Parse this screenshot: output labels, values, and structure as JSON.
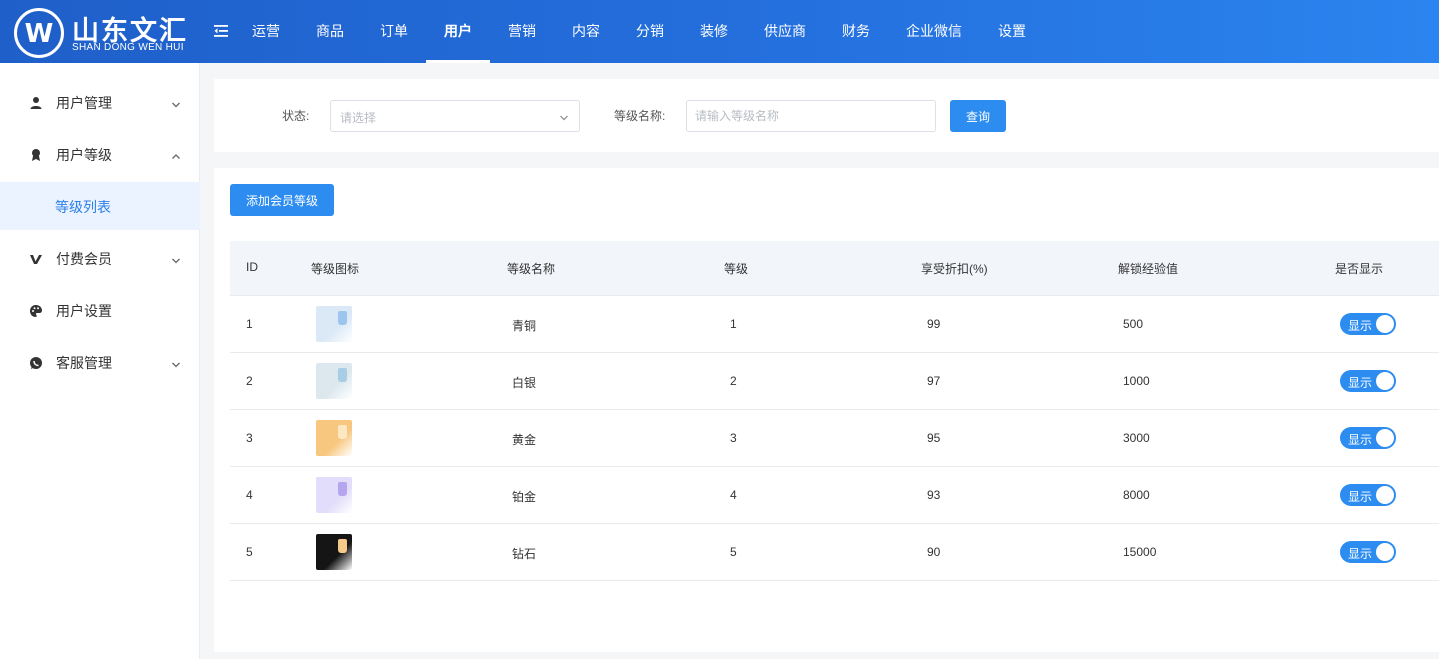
{
  "logo": {
    "name": "山东文汇",
    "subtitle": "SHAN DONG WEN HUI"
  },
  "nav": {
    "items": [
      "运营",
      "商品",
      "订单",
      "用户",
      "营销",
      "内容",
      "分销",
      "装修",
      "供应商",
      "财务",
      "企业微信",
      "设置"
    ],
    "active_index": 3
  },
  "sidebar": {
    "items": [
      {
        "label": "用户管理",
        "icon": "user-icon",
        "expanded": false
      },
      {
        "label": "用户等级",
        "icon": "level-icon",
        "expanded": true
      },
      {
        "label": "付费会员",
        "icon": "vip-icon",
        "expanded": false
      },
      {
        "label": "用户设置",
        "icon": "palette-icon"
      },
      {
        "label": "客服管理",
        "icon": "chat-icon",
        "expanded": false
      }
    ],
    "sub_item": "等级列表"
  },
  "filter": {
    "status_label": "状态:",
    "status_placeholder": "请选择",
    "name_label": "等级名称:",
    "name_placeholder": "请输入等级名称",
    "query_button": "查询"
  },
  "actions": {
    "add_button": "添加会员等级"
  },
  "table": {
    "columns": [
      "ID",
      "等级图标",
      "等级名称",
      "等级",
      "享受折扣(%)",
      "解锁经验值",
      "是否显示"
    ],
    "rows": [
      {
        "id": "1",
        "name": "青铜",
        "level": "1",
        "discount": "99",
        "exp": "500",
        "visible": "显示",
        "thumb_bg": "#dbe9f7",
        "gem": "#9cc6ee"
      },
      {
        "id": "2",
        "name": "白银",
        "level": "2",
        "discount": "97",
        "exp": "1000",
        "visible": "显示",
        "thumb_bg": "#dde8ee",
        "gem": "#a8cde6"
      },
      {
        "id": "3",
        "name": "黄金",
        "level": "3",
        "discount": "95",
        "exp": "3000",
        "visible": "显示",
        "thumb_bg": "#f7c77f",
        "gem": "#fde8c2"
      },
      {
        "id": "4",
        "name": "铂金",
        "level": "4",
        "discount": "93",
        "exp": "8000",
        "visible": "显示",
        "thumb_bg": "#e1ddfa",
        "gem": "#b6a6ef"
      },
      {
        "id": "5",
        "name": "钻石",
        "level": "5",
        "discount": "90",
        "exp": "15000",
        "visible": "显示",
        "thumb_bg": "#151515",
        "gem": "#f5c98a"
      }
    ]
  },
  "colors": {
    "primary": "#2d8cf0",
    "header_start": "#1f5fc9",
    "header_end": "#2b84ef",
    "active_bg": "#eaf3ff"
  }
}
